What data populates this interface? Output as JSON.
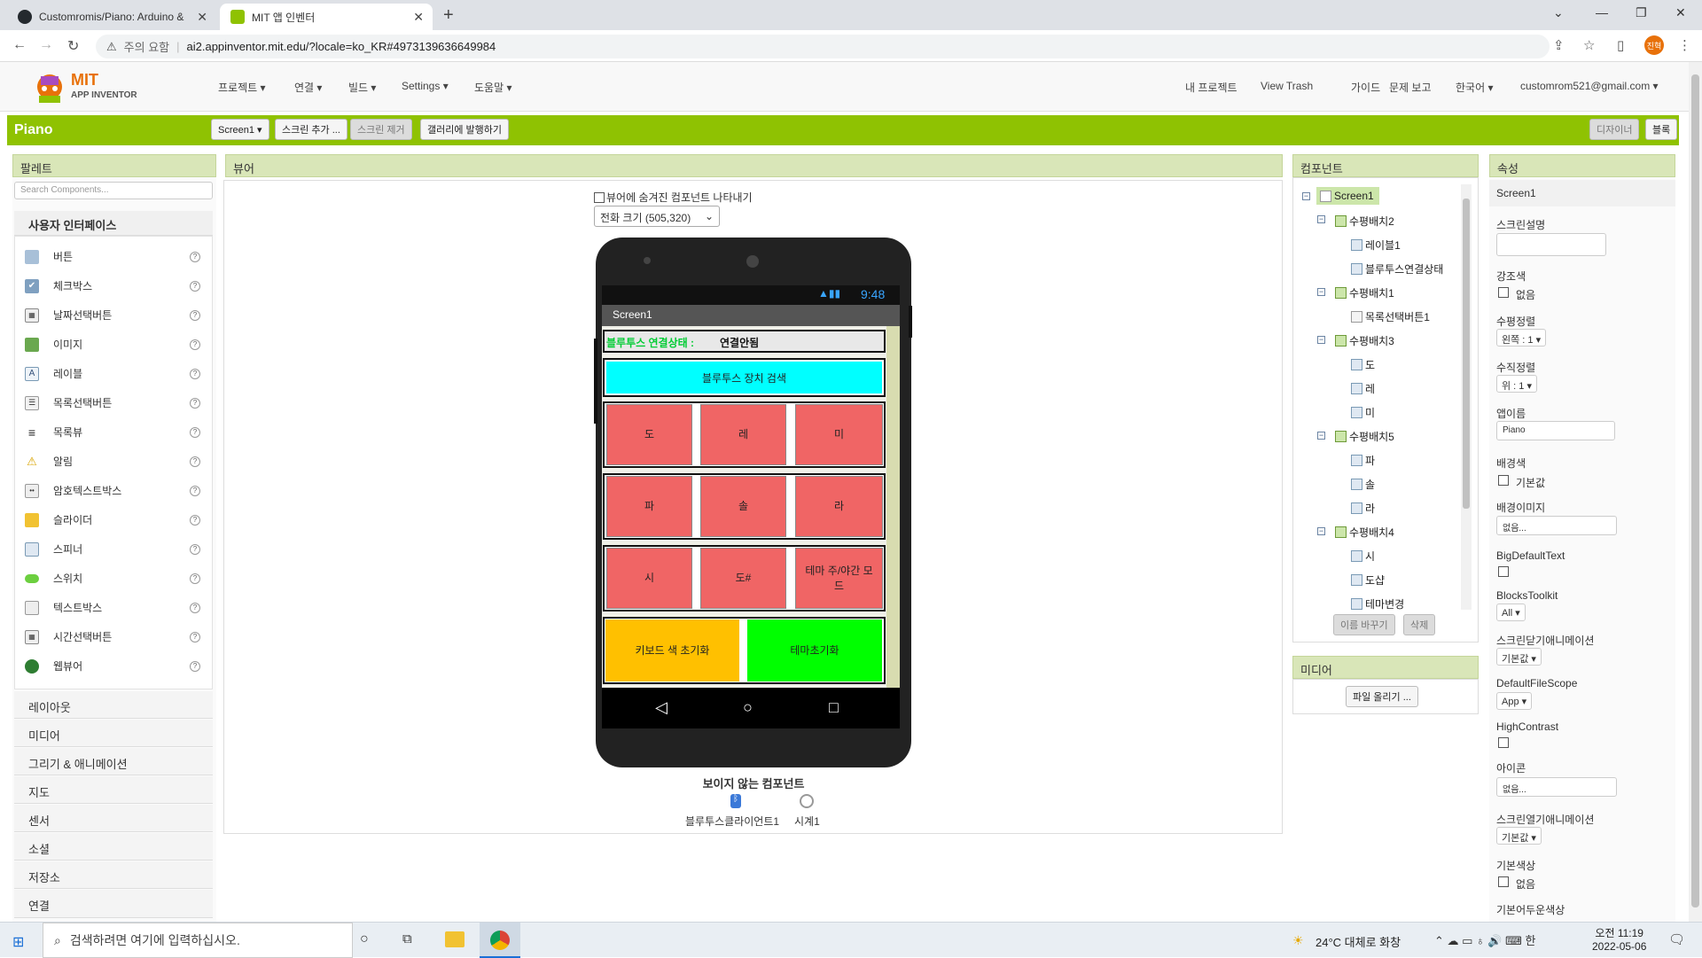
{
  "browser": {
    "tabs": [
      {
        "label": "Customromis/Piano: Arduino &"
      },
      {
        "label": "MIT 앱 인벤터"
      }
    ],
    "security": "주의 요함",
    "url": "ai2.appinventor.mit.edu/?locale=ko_KR#4973139636649984",
    "profile": "진혁"
  },
  "app": {
    "logo_top": "MIT",
    "logo_bottom": "APP INVENTOR",
    "menus": [
      "프로젝트 ▾",
      "연결 ▾",
      "빌드 ▾",
      "Settings ▾",
      "도움말 ▾"
    ],
    "right_menus": [
      "내 프로젝트",
      "View Trash",
      "가이드",
      "문제 보고",
      "한국어 ▾",
      "customrom521@gmail.com ▾"
    ]
  },
  "toolbar": {
    "project": "Piano",
    "screen_select": "Screen1 ▾",
    "add_screen": "스크린 추가 ...",
    "remove_screen": "스크린 제거",
    "publish": "갤러리에 발행하기",
    "designer": "디자이너",
    "blocks": "블록"
  },
  "palette": {
    "title": "팔레트",
    "search_placeholder": "Search Components...",
    "category": "사용자 인터페이스",
    "items": [
      "버튼",
      "체크박스",
      "날짜선택버튼",
      "이미지",
      "레이블",
      "목록선택버튼",
      "목록뷰",
      "알림",
      "암호텍스트박스",
      "슬라이더",
      "스피너",
      "스위치",
      "텍스트박스",
      "시간선택버튼",
      "웹뷰어"
    ],
    "categories": [
      "레이아웃",
      "미디어",
      "그리기 & 애니메이션",
      "지도",
      "센서",
      "소셜",
      "저장소",
      "연결"
    ]
  },
  "viewer": {
    "title": "뷰어",
    "show_hidden": "뷰어에 숨겨진 컴포넌트 나타내기",
    "size_select": "전화 크기 (505,320)",
    "time": "9:48",
    "screen_title": "Screen1",
    "bt_label": "블루투스 연결상태 :",
    "bt_status": "연결안됨",
    "bt_search": "블루투스 장치 검색",
    "keys_row1": [
      "도",
      "레",
      "미"
    ],
    "keys_row2": [
      "파",
      "솔",
      "라"
    ],
    "keys_row3": [
      "시",
      "도#",
      "테마 주/야간 모드"
    ],
    "reset_key": "키보드 색 초기화",
    "reset_theme": "테마초기화",
    "nonvisible_title": "보이지 않는 컴포넌트",
    "nonvisible": [
      "블루투스클라이언트1",
      "시계1"
    ]
  },
  "components": {
    "title": "컴포넌트",
    "tree": [
      "Screen1",
      "수평배치2",
      "레이블1",
      "블루투스연결상태",
      "수평배치1",
      "목록선택버튼1",
      "수평배치3",
      "도",
      "레",
      "미",
      "수평배치5",
      "파",
      "솔",
      "라",
      "수평배치4",
      "시",
      "도샵",
      "테마변경"
    ],
    "rename": "이름 바꾸기",
    "delete": "삭제"
  },
  "media": {
    "title": "미디어",
    "upload": "파일 올리기 ..."
  },
  "properties": {
    "title": "속성",
    "target": "Screen1",
    "items": [
      {
        "label": "스크린설명",
        "value": ""
      },
      {
        "label": "강조색",
        "value": "없음"
      },
      {
        "label": "수평정렬",
        "value": "왼쪽 : 1 ▾"
      },
      {
        "label": "수직정렬",
        "value": "위 : 1 ▾"
      },
      {
        "label": "앱이름",
        "value": "Piano"
      },
      {
        "label": "배경색",
        "value": "기본값"
      },
      {
        "label": "배경이미지",
        "value": "없음..."
      },
      {
        "label": "BigDefaultText",
        "value": ""
      },
      {
        "label": "BlocksToolkit",
        "value": "All ▾"
      },
      {
        "label": "스크린닫기애니메이션",
        "value": "기본값 ▾"
      },
      {
        "label": "DefaultFileScope",
        "value": "App ▾"
      },
      {
        "label": "HighContrast",
        "value": ""
      },
      {
        "label": "아이콘",
        "value": "없음..."
      },
      {
        "label": "스크린열기애니메이션",
        "value": "기본값 ▾"
      },
      {
        "label": "기본색상",
        "value": "없음"
      },
      {
        "label": "기본어두운색상",
        "value": ""
      }
    ]
  },
  "taskbar": {
    "search": "검색하려면 여기에 입력하십시오.",
    "weather": "24°C 대체로 화창",
    "time": "오전 11:19",
    "date": "2022-05-06"
  },
  "colors": {
    "green": "#8fc202",
    "key_red": "#f06565",
    "cyan": "#00ffff",
    "orange": "#ffc000",
    "lime": "#00ff00"
  }
}
